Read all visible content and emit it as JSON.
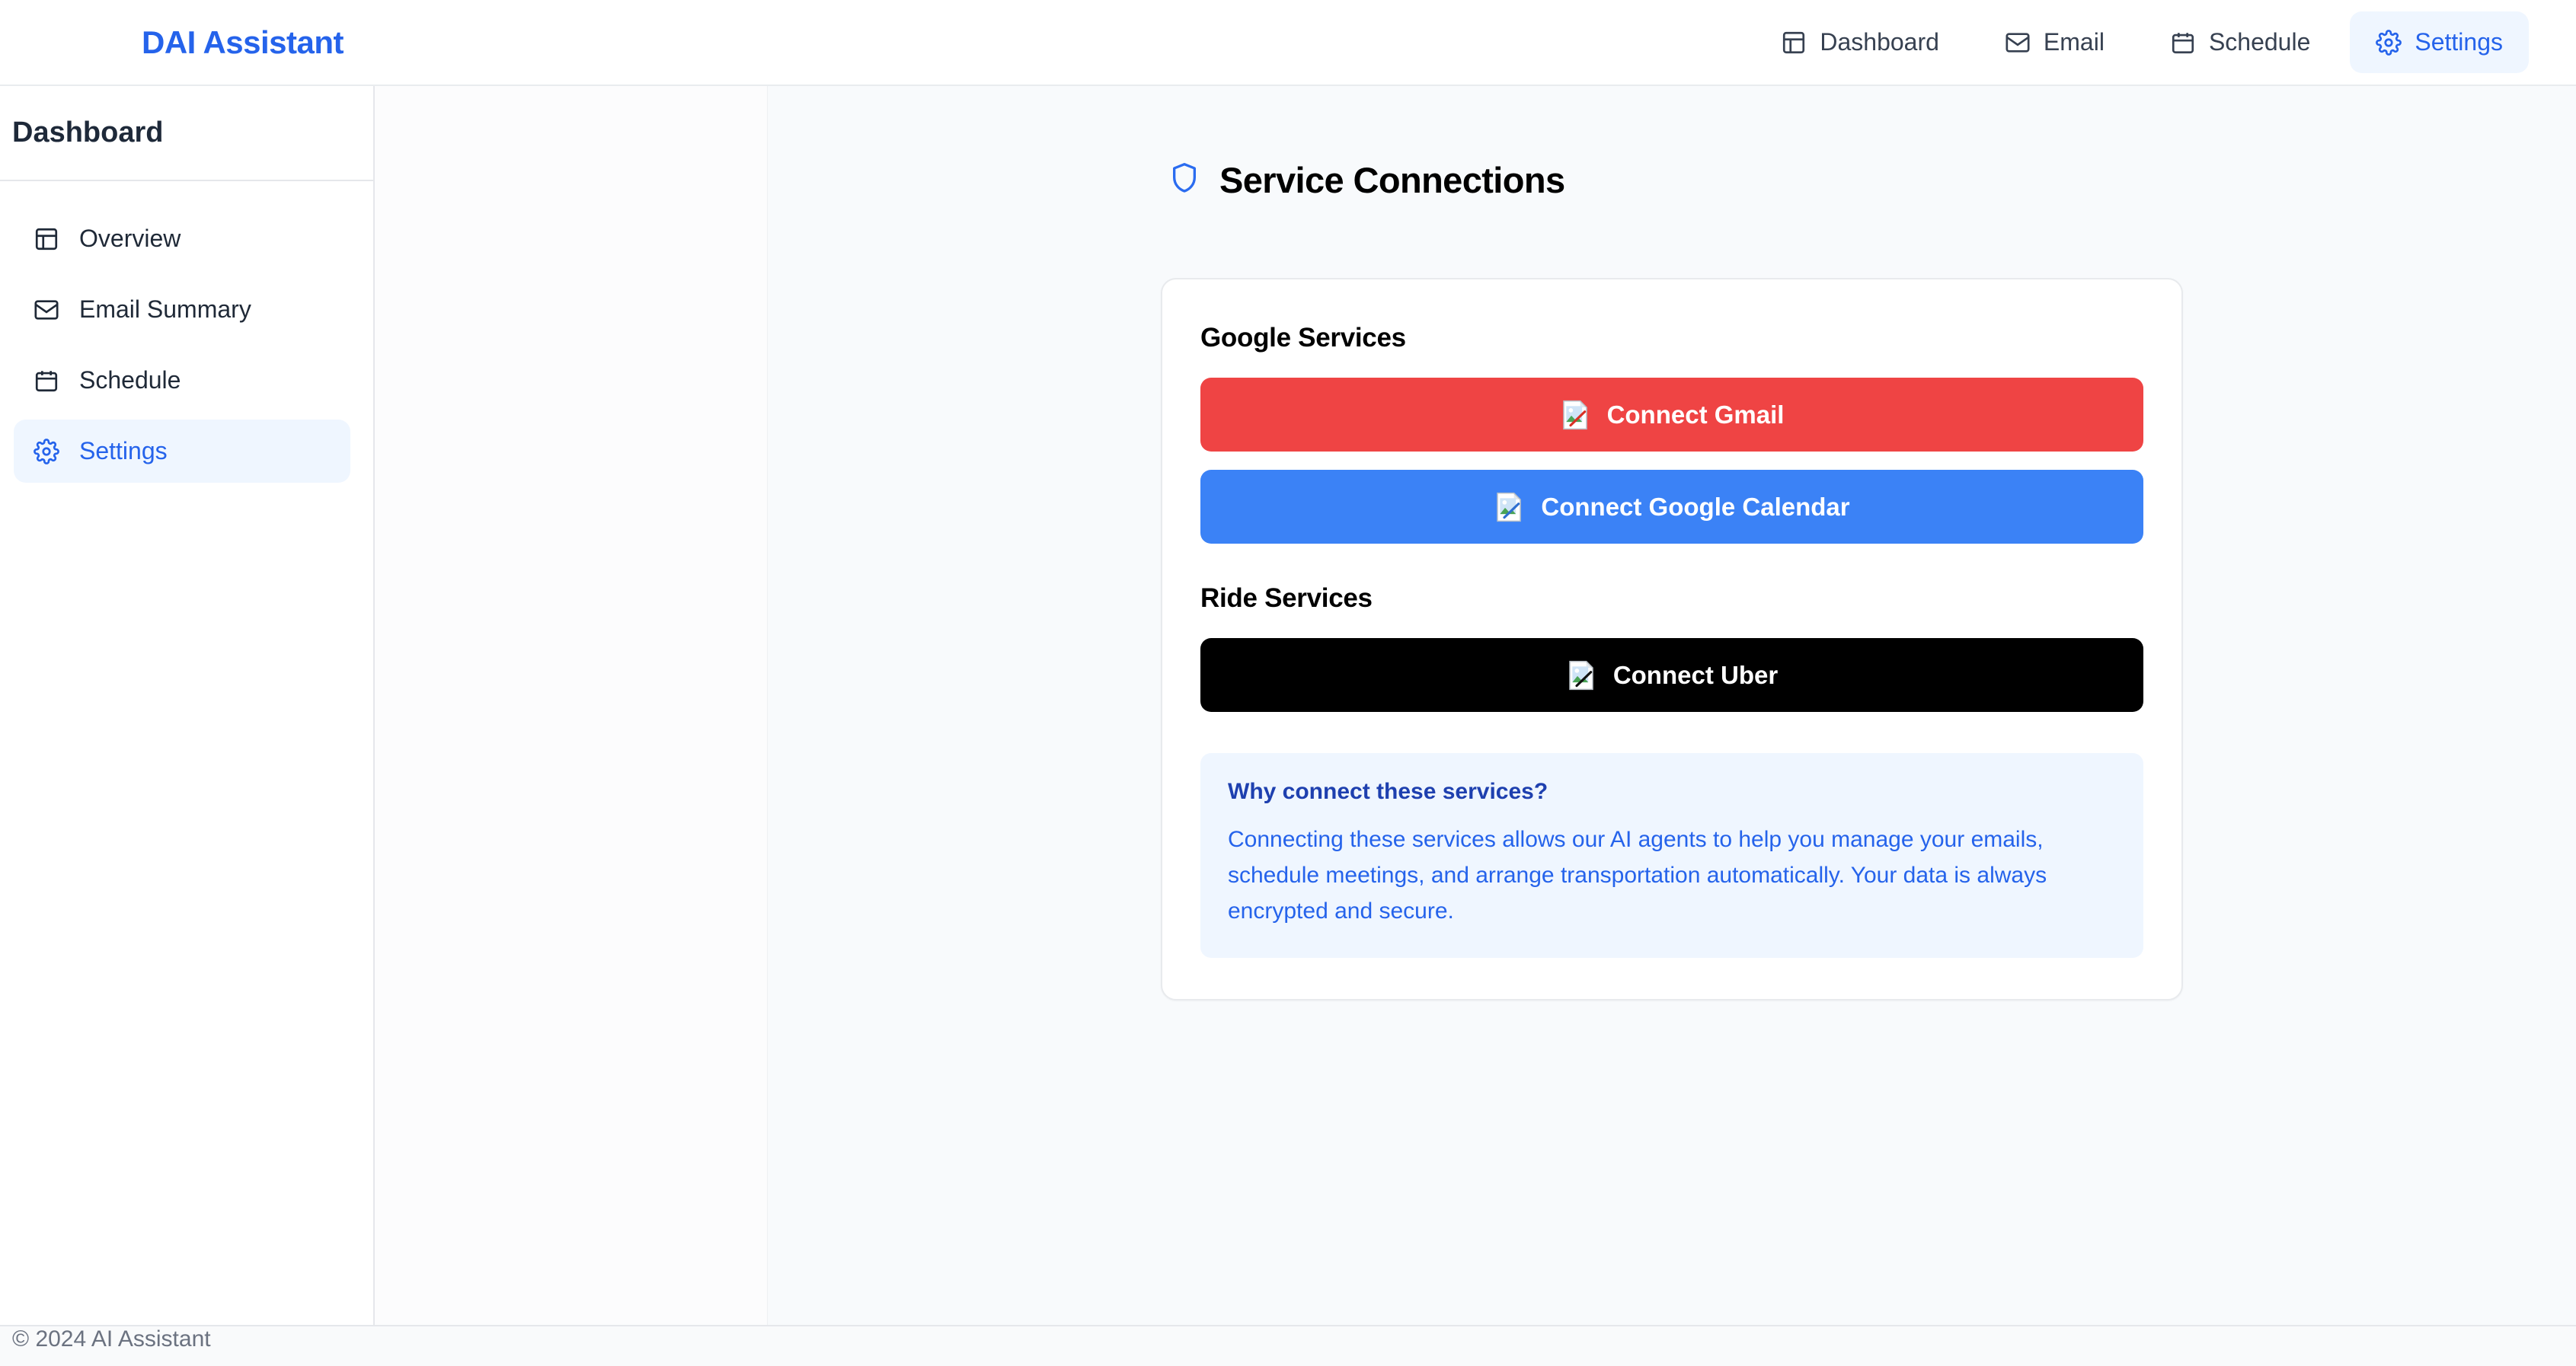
{
  "header": {
    "brand": "DAI Assistant",
    "nav": [
      {
        "label": "Dashboard",
        "icon": "layout-icon",
        "active": false
      },
      {
        "label": "Email",
        "icon": "mail-icon",
        "active": false
      },
      {
        "label": "Schedule",
        "icon": "calendar-icon",
        "active": false
      },
      {
        "label": "Settings",
        "icon": "gear-icon",
        "active": true
      }
    ]
  },
  "sidebar": {
    "title": "Dashboard",
    "items": [
      {
        "label": "Overview",
        "icon": "layout-icon",
        "active": false
      },
      {
        "label": "Email Summary",
        "icon": "mail-icon",
        "active": false
      },
      {
        "label": "Schedule",
        "icon": "calendar-icon",
        "active": false
      },
      {
        "label": "Settings",
        "icon": "gear-icon",
        "active": true
      }
    ]
  },
  "main": {
    "page_title": "Service Connections",
    "page_title_icon": "shield-icon",
    "sections": [
      {
        "title": "Google Services",
        "buttons": [
          {
            "label": "Connect Gmail",
            "color": "#EF4444",
            "icon": "broken-image-icon"
          },
          {
            "label": "Connect Google Calendar",
            "color": "#3B82F6",
            "icon": "broken-image-icon"
          }
        ]
      },
      {
        "title": "Ride Services",
        "buttons": [
          {
            "label": "Connect Uber",
            "color": "#000000",
            "icon": "broken-image-icon"
          }
        ]
      }
    ],
    "info": {
      "title": "Why connect these services?",
      "body": "Connecting these services allows our AI agents to help you manage your emails, schedule meetings, and arrange transportation automatically. Your data is always encrypted and secure."
    }
  },
  "footer": {
    "text": "© 2024 AI Assistant"
  },
  "colors": {
    "accent": "#2563EB",
    "accent_soft": "#EFF6FF",
    "gmail_red": "#EF4444",
    "calendar_blue": "#3B82F6",
    "uber_black": "#000000",
    "page_bg": "#F8FAFC"
  }
}
